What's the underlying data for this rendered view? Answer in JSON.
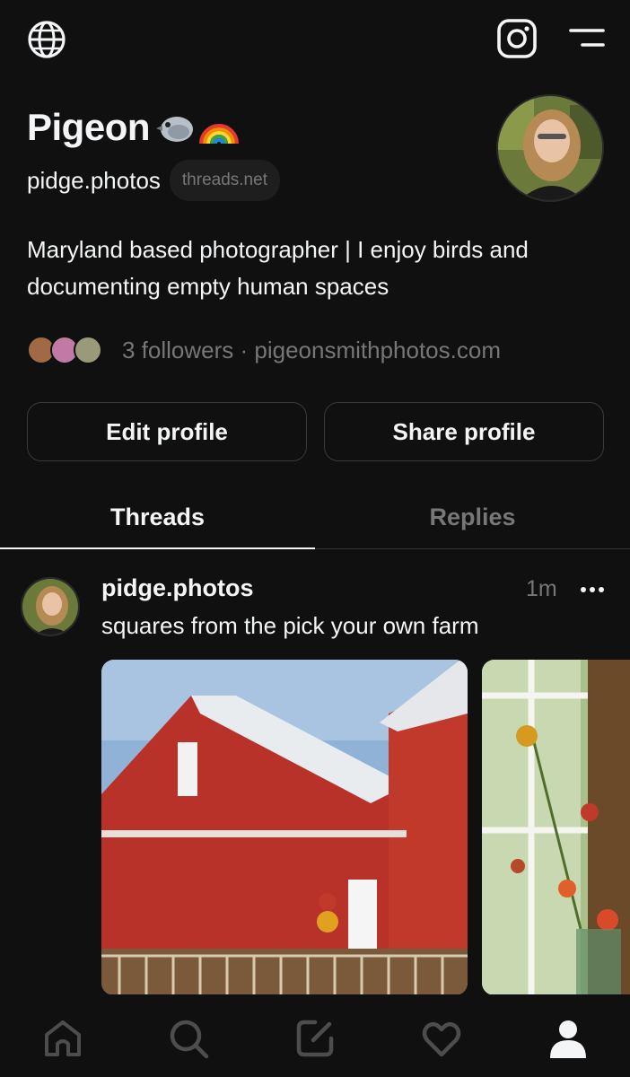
{
  "profile": {
    "display_name": "Pigeon",
    "name_emojis": [
      "pigeon-emoji",
      "rainbow-emoji"
    ],
    "handle": "pidge.photos",
    "domain_badge": "threads.net",
    "bio_line1": "Maryland based photographer | I enjoy birds and",
    "bio_line2": "documenting empty human spaces",
    "followers_text": "3 followers · pigeonsmithphotos.com"
  },
  "actions": {
    "edit_label": "Edit profile",
    "share_label": "Share profile"
  },
  "tabs": [
    {
      "label": "Threads",
      "active": true
    },
    {
      "label": "Replies",
      "active": false
    }
  ],
  "post": {
    "username": "pidge.photos",
    "time": "1m",
    "text": "squares from the pick your own farm",
    "media": [
      "red-barn-photo",
      "flower-window-photo"
    ]
  },
  "icons": {
    "top": [
      "globe-icon",
      "instagram-icon",
      "menu-icon"
    ],
    "nav": [
      "home-icon",
      "search-icon",
      "compose-icon",
      "heart-icon",
      "profile-icon"
    ]
  },
  "colors": {
    "background": "#101010",
    "text": "#f3f5f7",
    "muted": "#777777",
    "border": "#3a3a3a"
  }
}
